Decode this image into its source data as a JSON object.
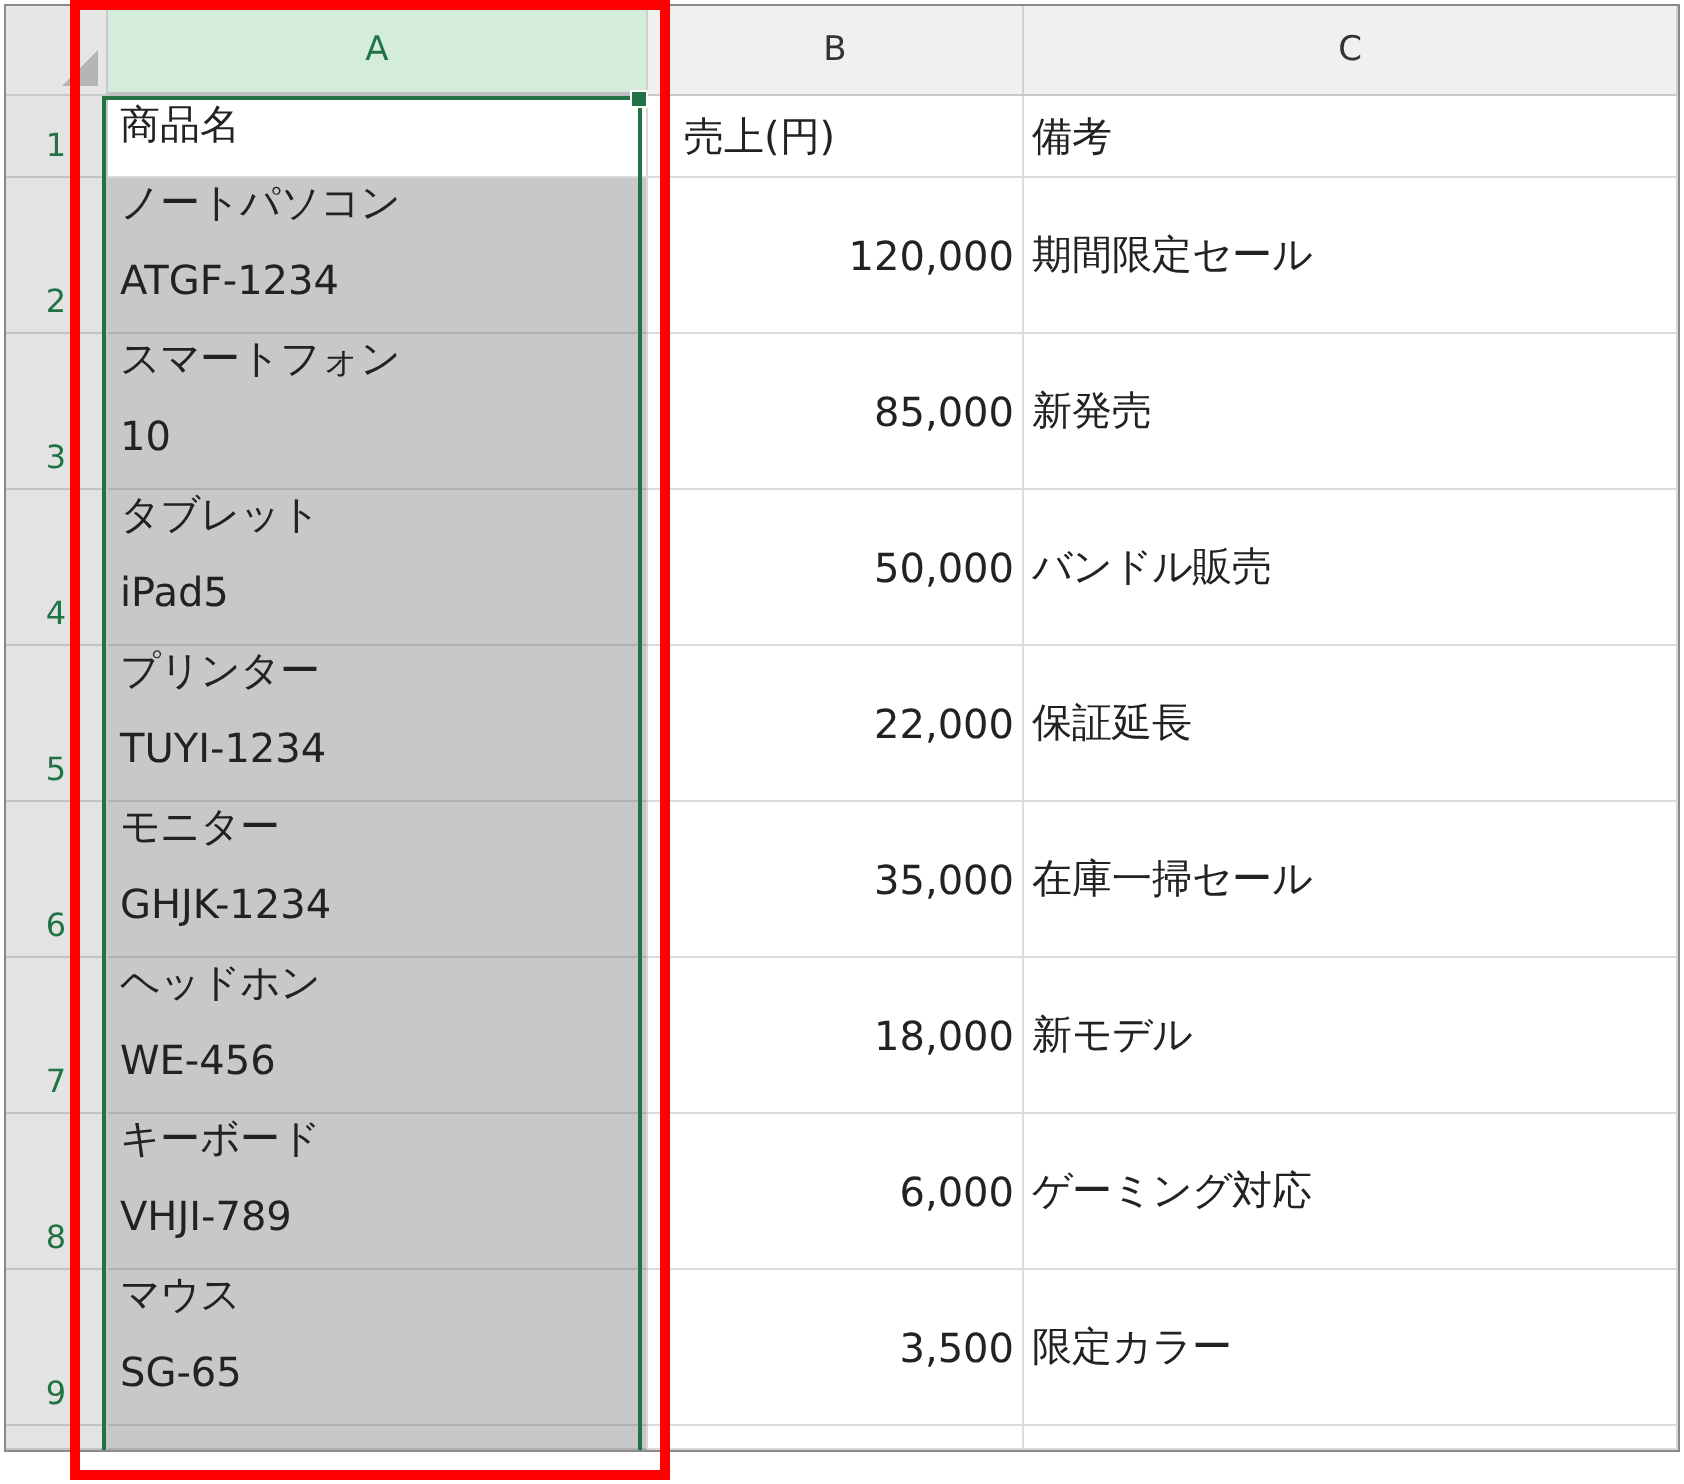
{
  "columns": [
    {
      "label": "A",
      "selected": true,
      "highlighted": true
    },
    {
      "label": "B",
      "selected": false,
      "highlighted": false
    },
    {
      "label": "C",
      "selected": false,
      "highlighted": false
    }
  ],
  "rows": [
    {
      "number": "1",
      "active": true,
      "product": [
        "商品名"
      ],
      "sales": "売上(円)",
      "note": "備考",
      "kind": "header"
    },
    {
      "number": "2",
      "active": false,
      "product": [
        "ノートパソコン",
        "ATGF-1234"
      ],
      "sales": "120,000",
      "note": "期間限定セール",
      "kind": "data"
    },
    {
      "number": "3",
      "active": false,
      "product": [
        "スマートフォン",
        "10"
      ],
      "sales": "85,000",
      "note": "新発売",
      "kind": "data"
    },
    {
      "number": "4",
      "active": false,
      "product": [
        "タブレット",
        "iPad5"
      ],
      "sales": "50,000",
      "note": "バンドル販売",
      "kind": "data"
    },
    {
      "number": "5",
      "active": false,
      "product": [
        "プリンター",
        "TUYI-1234"
      ],
      "sales": "22,000",
      "note": "保証延長",
      "kind": "data"
    },
    {
      "number": "6",
      "active": false,
      "product": [
        "モニター",
        "GHJK-1234"
      ],
      "sales": "35,000",
      "note": "在庫一掃セール",
      "kind": "data"
    },
    {
      "number": "7",
      "active": false,
      "product": [
        "ヘッドホン",
        "WE-456"
      ],
      "sales": "18,000",
      "note": "新モデル",
      "kind": "data"
    },
    {
      "number": "8",
      "active": false,
      "product": [
        "キーボード",
        "VHJI-789"
      ],
      "sales": "6,000",
      "note": "ゲーミング対応",
      "kind": "data"
    },
    {
      "number": "9",
      "active": false,
      "product": [
        "マウス",
        "SG-65"
      ],
      "sales": "3,500",
      "note": "限定カラー",
      "kind": "data"
    }
  ]
}
